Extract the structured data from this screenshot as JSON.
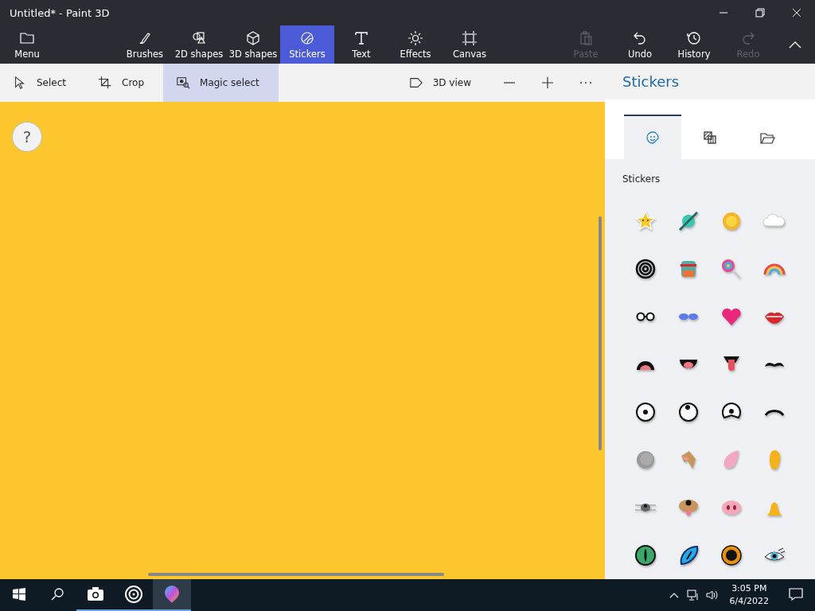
{
  "window": {
    "title": "Untitled* - Paint 3D"
  },
  "ribbon": {
    "menu": {
      "label": "Menu"
    },
    "tools": [
      {
        "label": "Brushes",
        "selected": false
      },
      {
        "label": "2D shapes",
        "selected": false
      },
      {
        "label": "3D shapes",
        "selected": false
      },
      {
        "label": "Stickers",
        "selected": true
      },
      {
        "label": "Text",
        "selected": false
      },
      {
        "label": "Effects",
        "selected": false
      },
      {
        "label": "Canvas",
        "selected": false
      }
    ],
    "actions": [
      {
        "label": "Paste",
        "disabled": true
      },
      {
        "label": "Undo",
        "disabled": false
      },
      {
        "label": "History",
        "disabled": false
      },
      {
        "label": "Redo",
        "disabled": true
      }
    ]
  },
  "toolbar": {
    "tools": [
      {
        "label": "Select",
        "selected": false
      },
      {
        "label": "Crop",
        "selected": false
      },
      {
        "label": "Magic select",
        "selected": true
      }
    ],
    "view": {
      "label": "3D view"
    }
  },
  "canvas": {
    "help": "?"
  },
  "panel": {
    "title": "Stickers",
    "tabs": [
      {
        "selected": true
      },
      {
        "selected": false
      },
      {
        "selected": false
      }
    ],
    "section": "Stickers"
  },
  "taskbar": {
    "apps": [
      {
        "running": true,
        "active": false
      },
      {
        "running": true,
        "active": false
      },
      {
        "running": true,
        "active": true
      }
    ],
    "time": "3:05 PM",
    "date": "6/4/2022"
  }
}
